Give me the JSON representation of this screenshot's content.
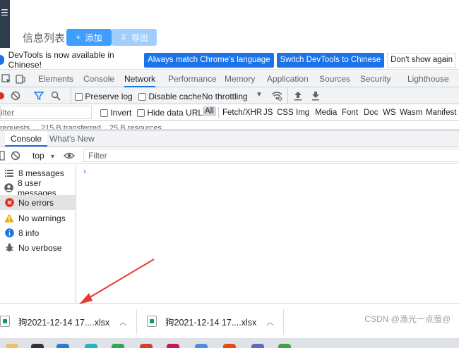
{
  "app": {
    "page_title": "信息列表",
    "add_label": "添加",
    "export_label": "导出"
  },
  "infobar": {
    "message": "DevTools is now available in Chinese!",
    "btn_match": "Always match Chrome's language",
    "btn_switch": "Switch DevTools to Chinese",
    "btn_dismiss": "Don't show again"
  },
  "tabs": [
    "Elements",
    "Console",
    "Network",
    "Performance",
    "Memory",
    "Application",
    "Sources",
    "Security",
    "Lighthouse"
  ],
  "active_tab": "Network",
  "network_toolbar": {
    "preserve_log": "Preserve log",
    "disable_cache": "Disable cache",
    "throttling": "No throttling"
  },
  "filter_row": {
    "filter_placeholder": "ilter",
    "invert": "Invert",
    "hide_data_urls": "Hide data URLs",
    "types": [
      "All",
      "Fetch/XHR",
      "JS",
      "CSS",
      "Img",
      "Media",
      "Font",
      "Doc",
      "WS",
      "Wasm",
      "Manifest"
    ]
  },
  "status_row": [
    "requests",
    "215 B transferred",
    "25 B resources"
  ],
  "drawer": {
    "tabs": [
      "Console",
      "What's New"
    ],
    "context": "top",
    "filter_placeholder": "Filter"
  },
  "console_sidebar": [
    {
      "label": "8 messages",
      "icon": "list-icon"
    },
    {
      "label": "8 user messages",
      "icon": "user-icon"
    },
    {
      "label": "No errors",
      "icon": "error-icon"
    },
    {
      "label": "No warnings",
      "icon": "warning-icon"
    },
    {
      "label": "8 info",
      "icon": "info-icon"
    },
    {
      "label": "No verbose",
      "icon": "bug-icon"
    }
  ],
  "downloads": [
    {
      "name": "狗2021-12-14 17....xlsx"
    },
    {
      "name": "狗2021-12-14 17....xlsx"
    }
  ],
  "watermark": "CSDN @渔光一点萤@",
  "colors": {
    "accent": "#1a73e8",
    "app_primary": "#409eff",
    "app_primary_light": "#a0cfff",
    "sidebar_dark": "#2f3c4b",
    "annotation_arrow": "#e53935"
  }
}
